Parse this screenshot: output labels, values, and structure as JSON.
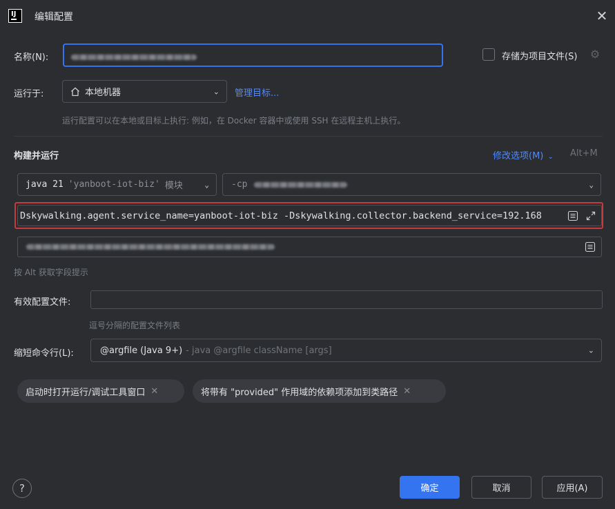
{
  "window": {
    "title": "编辑配置"
  },
  "name_field": {
    "label": "名称(N):",
    "value": "yanboot-iot-biz"
  },
  "store_as_file": {
    "label": "存储为项目文件(S)",
    "checked": false
  },
  "run_on": {
    "label": "运行于:",
    "value": "本地机器",
    "manage_link": "管理目标...",
    "hint": "运行配置可以在本地或目标上执行: 例如，在 Docker 容器中或使用 SSH 在远程主机上执行。"
  },
  "build_run": {
    "title": "构建并运行",
    "modify_options": "修改选项(M)",
    "modify_shortcut": "Alt+M",
    "jdk": {
      "keyword": "java 21",
      "module": "'yanboot-iot-biz'",
      "suffix": "模块"
    },
    "classpath": {
      "prefix": "-cp",
      "value": "yanboot-iot-biz"
    },
    "vm_options": "Dskywalking.agent.service_name=yanboot-iot-biz -Dskywalking.collector.backend_service=192.168",
    "main_class": "com.yanboot.iot.YanbootIotBizApplication",
    "alt_hint": "按 Alt 获取字段提示"
  },
  "active_profiles": {
    "label": "有效配置文件:",
    "value": "",
    "hint": "逗号分隔的配置文件列表"
  },
  "shorten_cmd": {
    "label": "缩短命令行(L):",
    "value": "@argfile (Java 9+)",
    "description": "- java @argfile className [args]"
  },
  "chips": [
    {
      "label": "启动时打开运行/调试工具窗口"
    },
    {
      "label": "将带有 \"provided\" 作用域的依赖项添加到类路径"
    }
  ],
  "footer": {
    "help": "?",
    "ok": "确定",
    "cancel": "取消",
    "apply": "应用(A)"
  },
  "colors": {
    "background": "#2b2d30",
    "accent": "#3574f0",
    "link": "#548af7",
    "highlight_border": "#c83b3b"
  }
}
